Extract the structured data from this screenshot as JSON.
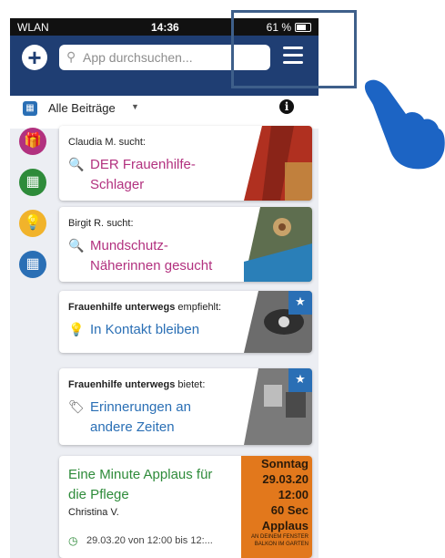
{
  "status": {
    "carrier": "WLAN",
    "time": "14:36",
    "battery": "61 %"
  },
  "header": {
    "search_placeholder": "App durchsuchen..."
  },
  "filter": {
    "label": "Alle Beiträge"
  },
  "cards": [
    {
      "author": "Claudia M.",
      "verb": "sucht:",
      "title_line1": "DER Frauenhilfe-",
      "title_line2": "Schlager"
    },
    {
      "author": "Birgit R.",
      "verb": "sucht:",
      "title_line1": "Mundschutz-",
      "title_line2": "Näherinnen gesucht"
    },
    {
      "author": "Frauenhilfe unterwegs",
      "verb": "empfiehlt:",
      "title_line1": "In Kontakt bleiben"
    },
    {
      "author": "Frauenhilfe unterwegs",
      "verb": "bietet:",
      "title_line1": "Erinnerungen an",
      "title_line2": "andere Zeiten"
    },
    {
      "title_line1": "Eine Minute Applaus für",
      "title_line2": "die Pflege",
      "author": "Christina V.",
      "date": "29.03.20 von 12:00 bis 12:..."
    }
  ],
  "poster": {
    "l1": "Sonntag",
    "l2": "29.03.20",
    "l3": "12:00",
    "l4": "60 Sec",
    "l5": "Applaus",
    "l6": "AN DEINEM FENSTER",
    "l7": "BALKON IM GARTEN"
  },
  "colors": {
    "header": "#1f3e73",
    "magenta": "#b2317f",
    "blue": "#2a6fb5",
    "green": "#2e8b3a"
  }
}
